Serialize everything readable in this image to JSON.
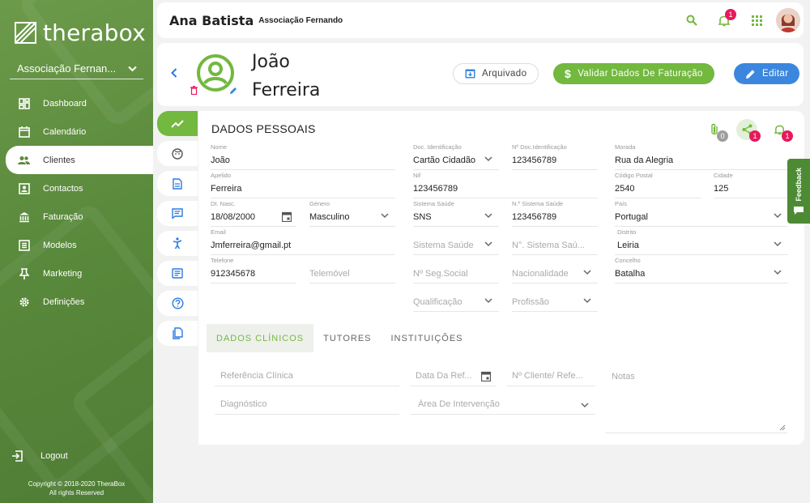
{
  "app": {
    "name": "therabox"
  },
  "sidebar": {
    "org_select": "Associação Fernan...",
    "items": [
      {
        "label": "Dashboard",
        "icon": "dashboard-icon"
      },
      {
        "label": "Calendário",
        "icon": "calendar-icon"
      },
      {
        "label": "Clientes",
        "icon": "clients-icon",
        "active": true
      },
      {
        "label": "Contactos",
        "icon": "contacts-icon"
      },
      {
        "label": "Faturação",
        "icon": "bank-icon"
      },
      {
        "label": "Modelos",
        "icon": "models-icon"
      },
      {
        "label": "Marketing",
        "icon": "pin-icon"
      },
      {
        "label": "Definições",
        "icon": "gear-icon"
      }
    ],
    "logout": "Logout",
    "copyright_line1": "Copyright © 2018-2020 TheraBox",
    "copyright_line2": "All rights Reserved"
  },
  "topbar": {
    "user": "Ana Batista",
    "org": "Associação Fernando",
    "notification_count": "1"
  },
  "client": {
    "first_name": "João",
    "last_name": "Ferreira",
    "archive_label": "Arquivado",
    "validate_label": "Validar Dados De Faturação",
    "edit_label": "Editar"
  },
  "section": {
    "title": "DADOS PESSOAIS",
    "attachments_count": "0",
    "shares_count": "1",
    "alerts_count": "1"
  },
  "fields": {
    "nome": {
      "label": "Nome",
      "value": "João"
    },
    "doc_id": {
      "label": "Doc. Identificação",
      "value": "Cartão Cidadão"
    },
    "n_doc_id": {
      "label": "Nº Doc.Identificação",
      "value": "123456789"
    },
    "morada": {
      "label": "Morada",
      "value": "Rua da Alegria"
    },
    "apelido": {
      "label": "Apelido",
      "value": "Ferreira"
    },
    "nif": {
      "label": "Nif",
      "value": "123456789"
    },
    "cod_postal": {
      "label": "Código Postal",
      "value": "2540"
    },
    "cidade": {
      "label": "Cidade",
      "value": "125"
    },
    "dt_nasc": {
      "label": "Dt. Nasc.",
      "value": "18/08/2000"
    },
    "genero": {
      "label": "Género",
      "value": "Masculino"
    },
    "sistema_saude": {
      "label": "Sistema Saúde",
      "value": "SNS"
    },
    "n_sistema_saude": {
      "label": "N.º Sistema Saúde",
      "value": "123456789"
    },
    "pais": {
      "label": "País",
      "value": "Portugal"
    },
    "email": {
      "label": "Email",
      "value": "Jmferreira@gmail.pt"
    },
    "sistema_saude_2": {
      "placeholder": "Sistema Saúde"
    },
    "n_sistema_saude_2": {
      "placeholder": "N°. Sistema Saú..."
    },
    "distrito": {
      "label": "Distrito",
      "value": "Leiria"
    },
    "telefone": {
      "label": "Telefone",
      "value": "912345678"
    },
    "telemovel": {
      "placeholder": "Telemóvel"
    },
    "seg_social": {
      "placeholder": "Nº Seg.Social"
    },
    "nacionalidade": {
      "placeholder": "Nacionalidade"
    },
    "concelho": {
      "label": "Concelho",
      "value": "Batalha"
    },
    "qualificacao": {
      "placeholder": "Qualificação"
    },
    "profissao": {
      "placeholder": "Profissão"
    }
  },
  "tabs": [
    "DADOS CLÍNICOS",
    "TUTORES",
    "INSTITUIÇÕES"
  ],
  "clinical": {
    "ref_clinica": "Referência Clínica",
    "data_ref": "Data Da Ref...",
    "n_cliente_ref": "Nº Cliente/ Refe...",
    "notas": "Notas",
    "diagnostico": "Diagnóstico",
    "area_intervencao": "Área De Intervenção"
  },
  "feedback_label": "Feedback",
  "colors": {
    "green": "#73b83f",
    "blue": "#3b87de",
    "badge": "#e8185c"
  }
}
